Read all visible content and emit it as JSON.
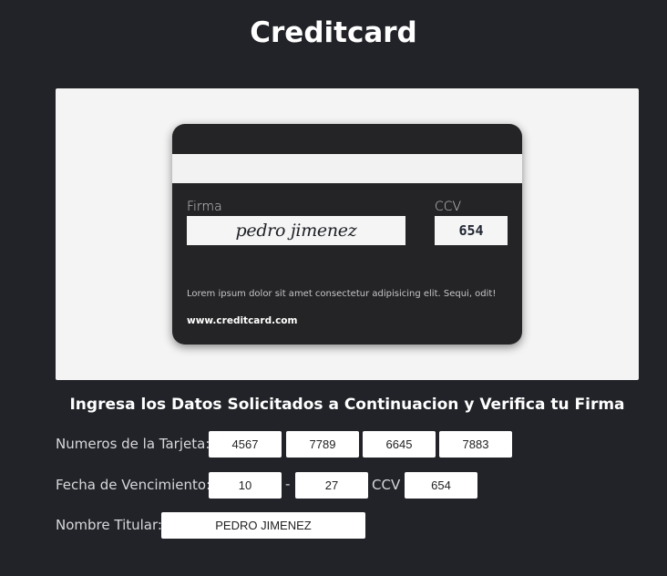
{
  "page": {
    "title": "Creditcard"
  },
  "card_back": {
    "signature_label": "Firma",
    "ccv_label": "CCV",
    "signature": "pedro jimenez",
    "ccv": "654",
    "disclaimer": "Lorem ipsum dolor sit amet consectetur adipisicing elit. Sequi, odit!",
    "website": "www.creditcard.com"
  },
  "form": {
    "instructions": "Ingresa los Datos Solicitados a Continuacion y Verifica tu Firma",
    "card_number_label": "Numeros de la Tarjeta:",
    "card_number_groups": [
      "4567",
      "7789",
      "6645",
      "7883"
    ],
    "expiry_label": "Fecha de Vencimiento:",
    "expiry_month": "10",
    "expiry_separator": "-",
    "expiry_year": "27",
    "ccv_label": "CCV",
    "ccv": "654",
    "holder_label": "Nombre Titular:",
    "holder_name": "PEDRO JIMENEZ"
  },
  "colors": {
    "background": "#212328",
    "card": "#242426",
    "preview_panel": "#f4f4f4"
  }
}
